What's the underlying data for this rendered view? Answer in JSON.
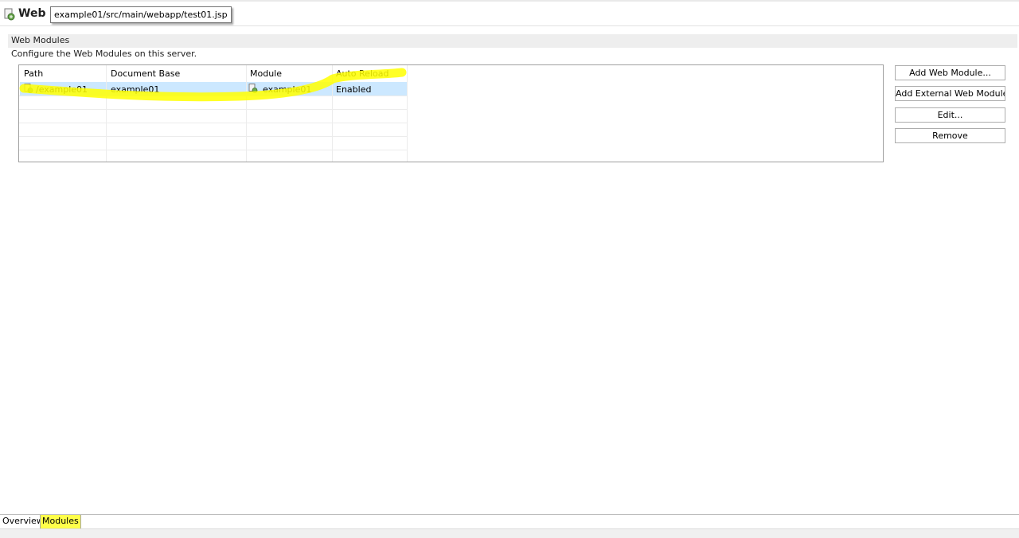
{
  "header": {
    "title": "Web M",
    "tooltip": "example01/src/main/webapp/test01.jsp"
  },
  "section": {
    "title": "Web Modules",
    "description": "Configure the Web Modules on this server."
  },
  "table": {
    "columns": [
      "Path",
      "Document Base",
      "Module",
      "Auto Reload"
    ],
    "rows": [
      {
        "path": "/example01",
        "document_base": "example01",
        "module": "example01",
        "auto_reload": "Enabled"
      }
    ]
  },
  "buttons": {
    "add_web_module": "Add Web Module...",
    "add_external_web_module": "Add External Web Module...",
    "edit": "Edit...",
    "remove": "Remove"
  },
  "tabs": [
    "Overview",
    "Modules"
  ],
  "colors": {
    "highlighter": "#ffff00",
    "selection": "#cce8ff"
  },
  "icons": {
    "module": "web-module-icon"
  }
}
